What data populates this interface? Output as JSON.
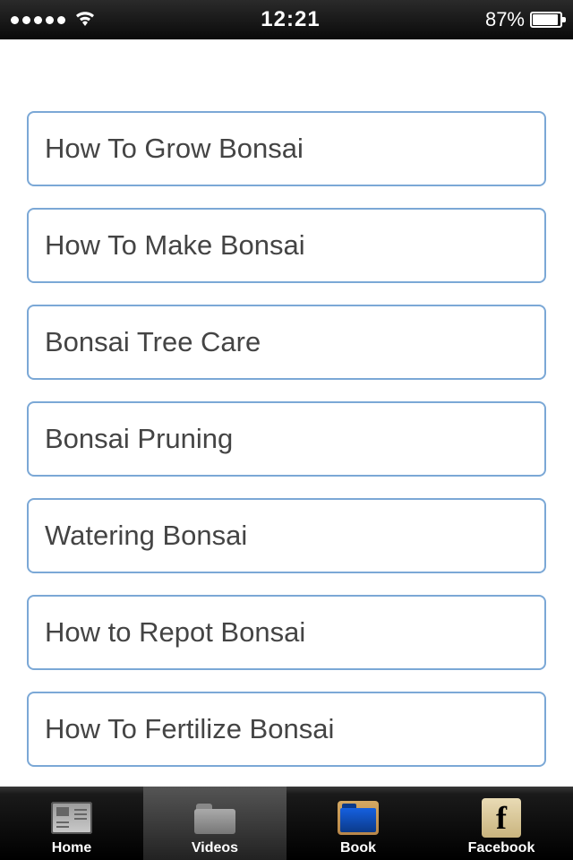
{
  "status": {
    "time": "12:21",
    "battery_pct": "87%"
  },
  "list": {
    "items": [
      {
        "label": "How To Grow Bonsai"
      },
      {
        "label": "How To Make Bonsai"
      },
      {
        "label": "Bonsai Tree Care"
      },
      {
        "label": "Bonsai Pruning"
      },
      {
        "label": "Watering Bonsai"
      },
      {
        "label": "How to Repot Bonsai"
      },
      {
        "label": "How To Fertilize Bonsai"
      }
    ]
  },
  "tabs": {
    "home": "Home",
    "videos": "Videos",
    "book": "Book",
    "facebook": "Facebook",
    "fb_glyph": "f"
  }
}
